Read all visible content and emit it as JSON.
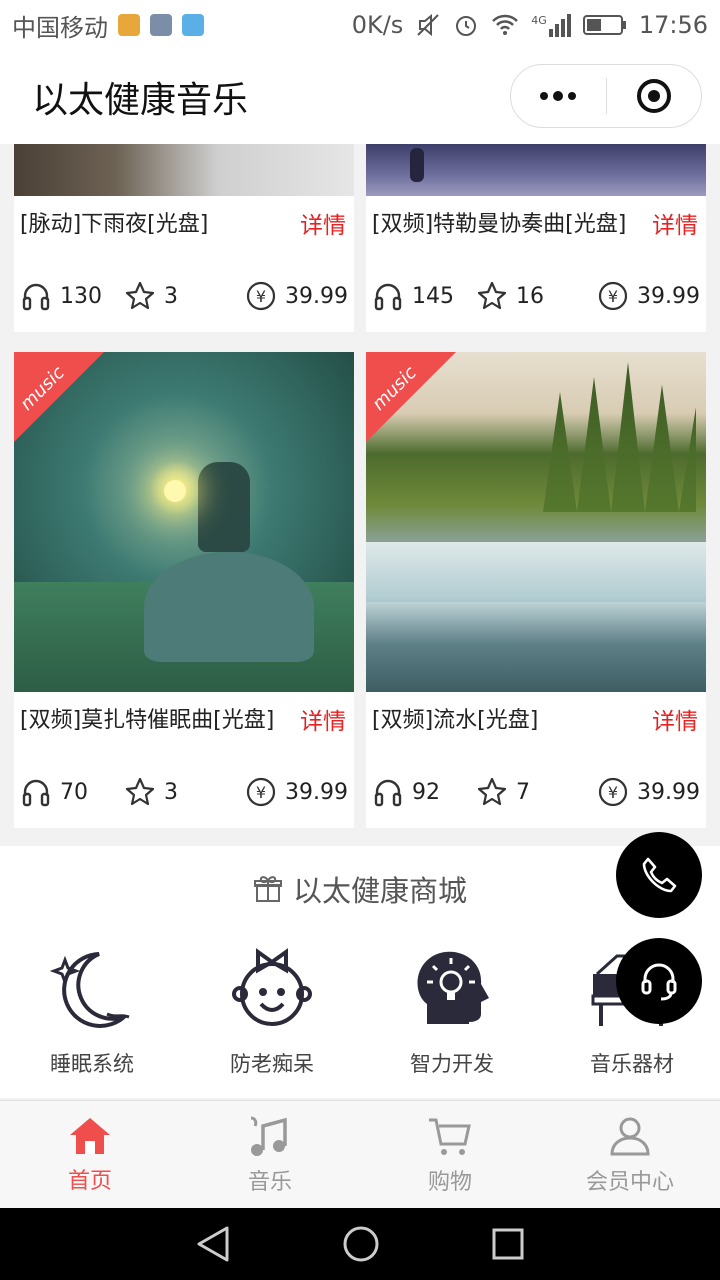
{
  "status_bar": {
    "carrier": "中国移动",
    "speed": "0K/s",
    "network": "4G",
    "time": "17:56"
  },
  "header": {
    "title": "以太健康音乐"
  },
  "cards": [
    {
      "name": "[脉动]下雨夜[光盘]",
      "detail": "详情",
      "plays": "130",
      "favorites": "3",
      "price": "39.99"
    },
    {
      "name": "[双频]特勒曼协奏曲[光盘]",
      "detail": "详情",
      "plays": "145",
      "favorites": "16",
      "price": "39.99"
    },
    {
      "name": "[双频]莫扎特催眠曲[光盘]",
      "detail": "详情",
      "plays": "70",
      "favorites": "3",
      "price": "39.99",
      "badge": "music"
    },
    {
      "name": "[双频]流水[光盘]",
      "detail": "详情",
      "plays": "92",
      "favorites": "7",
      "price": "39.99",
      "badge": "music"
    }
  ],
  "mall": {
    "title": "以太健康商城",
    "items": [
      {
        "label": "睡眠系统",
        "icon": "moon-stars-icon"
      },
      {
        "label": "防老痴呆",
        "icon": "child-face-icon"
      },
      {
        "label": "智力开发",
        "icon": "head-lightbulb-icon"
      },
      {
        "label": "音乐器材",
        "icon": "piano-icon"
      }
    ]
  },
  "tabs": [
    {
      "label": "首页",
      "icon": "home-icon",
      "active": true
    },
    {
      "label": "音乐",
      "icon": "music-note-icon",
      "active": false
    },
    {
      "label": "购物",
      "icon": "cart-icon",
      "active": false
    },
    {
      "label": "会员中心",
      "icon": "user-icon",
      "active": false
    }
  ],
  "colors": {
    "accent": "#f04d4d",
    "detail": "#e62222"
  }
}
